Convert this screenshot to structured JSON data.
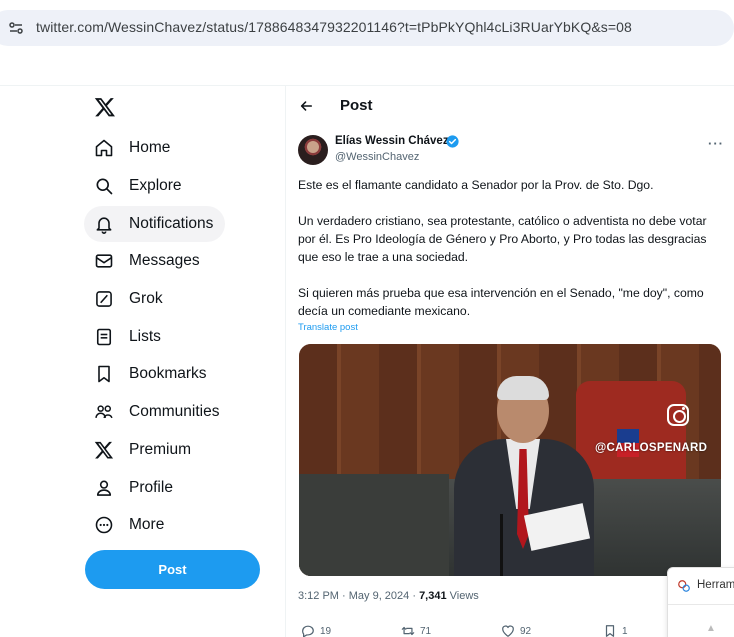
{
  "browser": {
    "url": "twitter.com/WessinChavez/status/1788648347932201146?t=tPbPkYQhl4cLi3RUarYbKQ&s=08",
    "site_icon": "site-settings-icon"
  },
  "nav": {
    "logo": "x-logo-icon",
    "items": [
      {
        "label": "Home",
        "icon": "home-icon"
      },
      {
        "label": "Explore",
        "icon": "search-icon"
      },
      {
        "label": "Notifications",
        "icon": "bell-icon"
      },
      {
        "label": "Messages",
        "icon": "mail-icon"
      },
      {
        "label": "Grok",
        "icon": "grok-icon"
      },
      {
        "label": "Lists",
        "icon": "list-icon"
      },
      {
        "label": "Bookmarks",
        "icon": "bookmark-icon"
      },
      {
        "label": "Communities",
        "icon": "communities-icon"
      },
      {
        "label": "Premium",
        "icon": "x-premium-icon"
      },
      {
        "label": "Profile",
        "icon": "profile-icon"
      },
      {
        "label": "More",
        "icon": "more-circle-icon"
      }
    ],
    "post_button": "Post"
  },
  "header": {
    "title": "Post"
  },
  "tweet": {
    "author_name": "Elías Wessin Chávez",
    "author_handle": "@WessinChavez",
    "paragraphs": [
      "Este es el flamante candidato a Senador por la Prov. de Sto. Dgo.",
      "Un verdadero cristiano, sea protestante, católico o adventista no debe votar por él.  Es Pro Ideología de Género y Pro Aborto, y Pro todas las desgracias que eso le trae a una sociedad.",
      "Si quieren más prueba que esa intervención en el Senado, \"me doy\", como decía un comediante mexicano."
    ],
    "translate": "Translate post",
    "media_watermark": "@CARLOSPENARD",
    "timestamp": "3:12 PM · May 9, 2024 · ",
    "views_count": "7,341",
    "views_label": " Views",
    "actions": {
      "replies": "19",
      "reposts": "71",
      "likes": "92",
      "bookmarks": "1"
    }
  },
  "popup": {
    "label": "Herram"
  },
  "colors": {
    "accent": "#1d9bf0",
    "text": "#0f1419",
    "muted": "#536471",
    "nav_active_bg": "#f3f3f5"
  }
}
